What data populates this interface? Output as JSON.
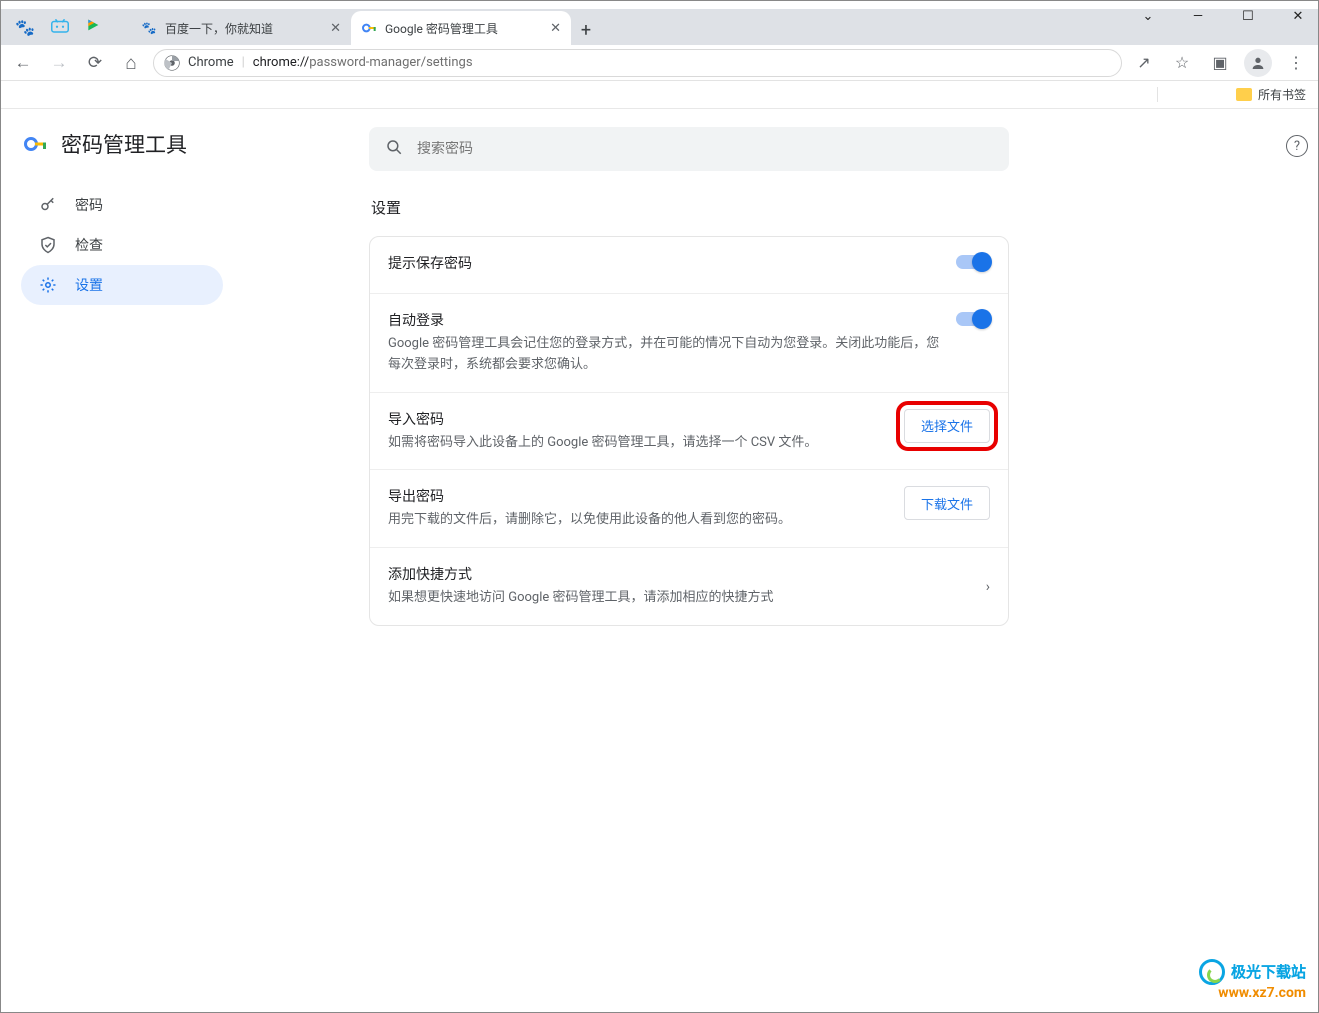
{
  "window": {
    "controls": {
      "chevron": "⌄",
      "min": "—",
      "max": "☐",
      "close": "✕"
    }
  },
  "tabs": {
    "tab1_label": "百度一下，你就知道",
    "tab2_label": "Google 密码管理工具",
    "close_glyph": "✕",
    "new_glyph": "+"
  },
  "nav": {
    "back": "←",
    "forward": "→",
    "reload": "⟳",
    "home": "⌂"
  },
  "url": {
    "security_label": "Chrome",
    "host": "chrome://",
    "path": "password-manager/settings"
  },
  "toolbar_right": {
    "share": "↗",
    "star": "☆",
    "panel": "▣",
    "profile": "👤",
    "menu": "⋮"
  },
  "bookmarks": {
    "all_label": "所有书签"
  },
  "brand": {
    "title": "密码管理工具"
  },
  "sidebar": {
    "items": [
      {
        "label": "密码"
      },
      {
        "label": "检查"
      },
      {
        "label": "设置"
      }
    ]
  },
  "search": {
    "placeholder": "搜索密码"
  },
  "section": {
    "title": "设置"
  },
  "settings": {
    "save_prompt": {
      "title": "提示保存密码"
    },
    "auto_login": {
      "title": "自动登录",
      "desc": "Google 密码管理工具会记住您的登录方式，并在可能的情况下自动为您登录。关闭此功能后，您每次登录时，系统都会要求您确认。"
    },
    "import": {
      "title": "导入密码",
      "desc": "如需将密码导入此设备上的 Google 密码管理工具，请选择一个 CSV 文件。",
      "button": "选择文件"
    },
    "export": {
      "title": "导出密码",
      "desc": "用完下载的文件后，请删除它，以免使用此设备的他人看到您的密码。",
      "button": "下载文件"
    },
    "shortcut": {
      "title": "添加快捷方式",
      "desc": "如果想更快速地访问 Google 密码管理工具，请添加相应的快捷方式"
    }
  },
  "watermark": {
    "line1": "极光下载站",
    "line2": "www.xz7.com"
  }
}
